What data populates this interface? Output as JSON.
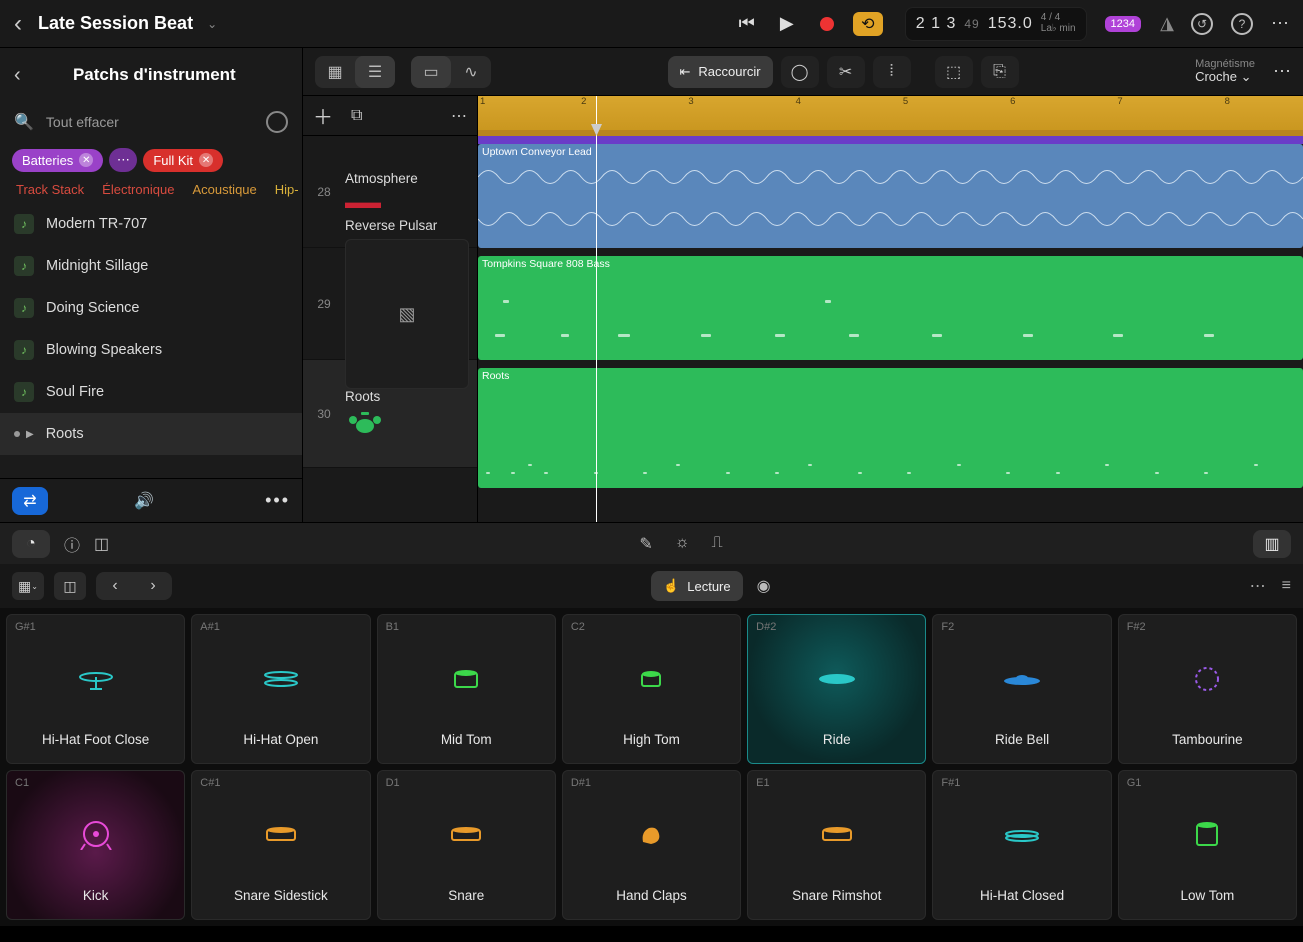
{
  "titlebar": {
    "title": "Late Session Beat"
  },
  "lcd": {
    "bars": "2 1 3",
    "beats_small": "49",
    "tempo": "153.0",
    "sig": "4 / 4",
    "key": "La♭ min",
    "scale": "1234"
  },
  "sidebar": {
    "title": "Patchs d'instrument",
    "clear_label": "Tout effacer",
    "tags": {
      "batteries": "Batteries",
      "fullkit": "Full Kit"
    },
    "cats": {
      "c1": "Track Stack",
      "c2": "Électronique",
      "c3": "Acoustique",
      "c4": "Hip-"
    },
    "patches": {
      "p0": "Modern TR-707",
      "p1": "Midnight Sillage",
      "p2": "Doing Science",
      "p3": "Blowing Speakers",
      "p4": "Soul Fire",
      "p5": "Roots"
    }
  },
  "arrange": {
    "func_label": "Raccourcir",
    "snap_label": "Magnétisme",
    "snap_value": "Croche",
    "ruler": {
      "n1": "1",
      "n2": "2",
      "n3": "3",
      "n4": "4",
      "n5": "5",
      "n6": "6",
      "n7": "7",
      "n8": "8"
    },
    "tracks": {
      "t1": {
        "num": "28",
        "name": "Atmosphere",
        "region": "Uptown Conveyor Lead"
      },
      "t2": {
        "num": "29",
        "name": "Reverse Pulsar",
        "region": "Tompkins Square 808 Bass"
      },
      "t3": {
        "num": "30",
        "name": "Roots",
        "region": "Roots"
      }
    }
  },
  "padbar": {
    "lecture": "Lecture"
  },
  "pads": {
    "row1": {
      "p0": {
        "note": "G#1",
        "label": "Hi-Hat Foot Close"
      },
      "p1": {
        "note": "A#1",
        "label": "Hi-Hat Open"
      },
      "p2": {
        "note": "B1",
        "label": "Mid Tom"
      },
      "p3": {
        "note": "C2",
        "label": "High Tom"
      },
      "p4": {
        "note": "D#2",
        "label": "Ride"
      },
      "p5": {
        "note": "F2",
        "label": "Ride Bell"
      },
      "p6": {
        "note": "F#2",
        "label": "Tambourine"
      }
    },
    "row2": {
      "p0": {
        "note": "C1",
        "label": "Kick"
      },
      "p1": {
        "note": "C#1",
        "label": "Snare Sidestick"
      },
      "p2": {
        "note": "D1",
        "label": "Snare"
      },
      "p3": {
        "note": "D#1",
        "label": "Hand Claps"
      },
      "p4": {
        "note": "E1",
        "label": "Snare Rimshot"
      },
      "p5": {
        "note": "F#1",
        "label": "Hi-Hat Closed"
      },
      "p6": {
        "note": "G1",
        "label": "Low Tom"
      }
    }
  }
}
